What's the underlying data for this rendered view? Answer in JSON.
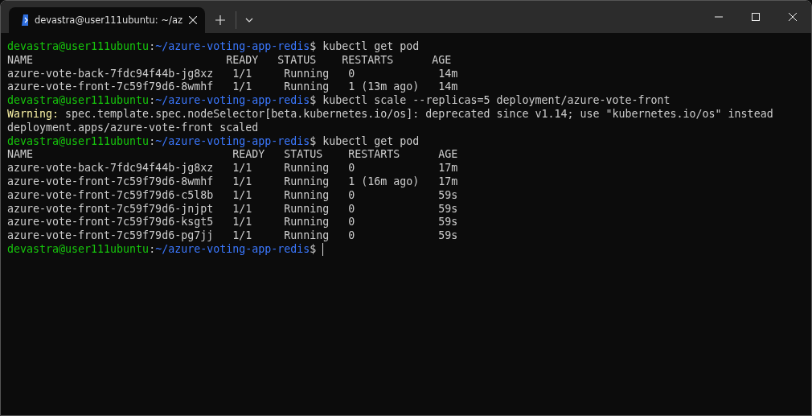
{
  "tabs": [
    {
      "title": "devastra@user111ubuntu: ~/az",
      "selected": true
    }
  ],
  "terminal": {
    "lines": [
      {
        "segments": [
          {
            "kind": "user",
            "text": "devastra@user111ubuntu"
          },
          {
            "kind": "plain",
            "text": ":"
          },
          {
            "kind": "path",
            "text": "~/azure-voting-app-redis"
          },
          {
            "kind": "plain",
            "text": "$ kubectl get pod"
          }
        ]
      },
      {
        "segments": [
          {
            "kind": "plain",
            "text": "NAME                              READY   STATUS    RESTARTS      AGE"
          }
        ]
      },
      {
        "segments": [
          {
            "kind": "plain",
            "text": "azure-vote-back-7fdc94f44b-jg8xz   1/1     Running   0             14m"
          }
        ]
      },
      {
        "segments": [
          {
            "kind": "plain",
            "text": "azure-vote-front-7c59f79d6-8wmhf   1/1     Running   1 (13m ago)   14m"
          }
        ]
      },
      {
        "segments": [
          {
            "kind": "user",
            "text": "devastra@user111ubuntu"
          },
          {
            "kind": "plain",
            "text": ":"
          },
          {
            "kind": "path",
            "text": "~/azure-voting-app-redis"
          },
          {
            "kind": "plain",
            "text": "$ kubectl scale --replicas=5 deployment/azure-vote-front"
          }
        ]
      },
      {
        "segments": [
          {
            "kind": "warning",
            "text": "Warning:"
          },
          {
            "kind": "plain",
            "text": " spec.template.spec.nodeSelector[beta.kubernetes.io/os]: deprecated since v1.14; use \"kubernetes.io/os\" instead"
          }
        ]
      },
      {
        "segments": [
          {
            "kind": "plain",
            "text": "deployment.apps/azure-vote-front scaled"
          }
        ]
      },
      {
        "segments": [
          {
            "kind": "user",
            "text": "devastra@user111ubuntu"
          },
          {
            "kind": "plain",
            "text": ":"
          },
          {
            "kind": "path",
            "text": "~/azure-voting-app-redis"
          },
          {
            "kind": "plain",
            "text": "$ kubectl get pod"
          }
        ]
      },
      {
        "segments": [
          {
            "kind": "plain",
            "text": "NAME                               READY   STATUS    RESTARTS      AGE"
          }
        ]
      },
      {
        "segments": [
          {
            "kind": "plain",
            "text": "azure-vote-back-7fdc94f44b-jg8xz   1/1     Running   0             17m"
          }
        ]
      },
      {
        "segments": [
          {
            "kind": "plain",
            "text": "azure-vote-front-7c59f79d6-8wmhf   1/1     Running   1 (16m ago)   17m"
          }
        ]
      },
      {
        "segments": [
          {
            "kind": "plain",
            "text": "azure-vote-front-7c59f79d6-c5l8b   1/1     Running   0             59s"
          }
        ]
      },
      {
        "segments": [
          {
            "kind": "plain",
            "text": "azure-vote-front-7c59f79d6-jnjpt   1/1     Running   0             59s"
          }
        ]
      },
      {
        "segments": [
          {
            "kind": "plain",
            "text": "azure-vote-front-7c59f79d6-ksgt5   1/1     Running   0             59s"
          }
        ]
      },
      {
        "segments": [
          {
            "kind": "plain",
            "text": "azure-vote-front-7c59f79d6-pg7jj   1/1     Running   0             59s"
          }
        ]
      },
      {
        "segments": [
          {
            "kind": "user",
            "text": "devastra@user111ubuntu"
          },
          {
            "kind": "plain",
            "text": ":"
          },
          {
            "kind": "path",
            "text": "~/azure-voting-app-redis"
          },
          {
            "kind": "plain",
            "text": "$ "
          }
        ],
        "cursor": true
      }
    ]
  }
}
